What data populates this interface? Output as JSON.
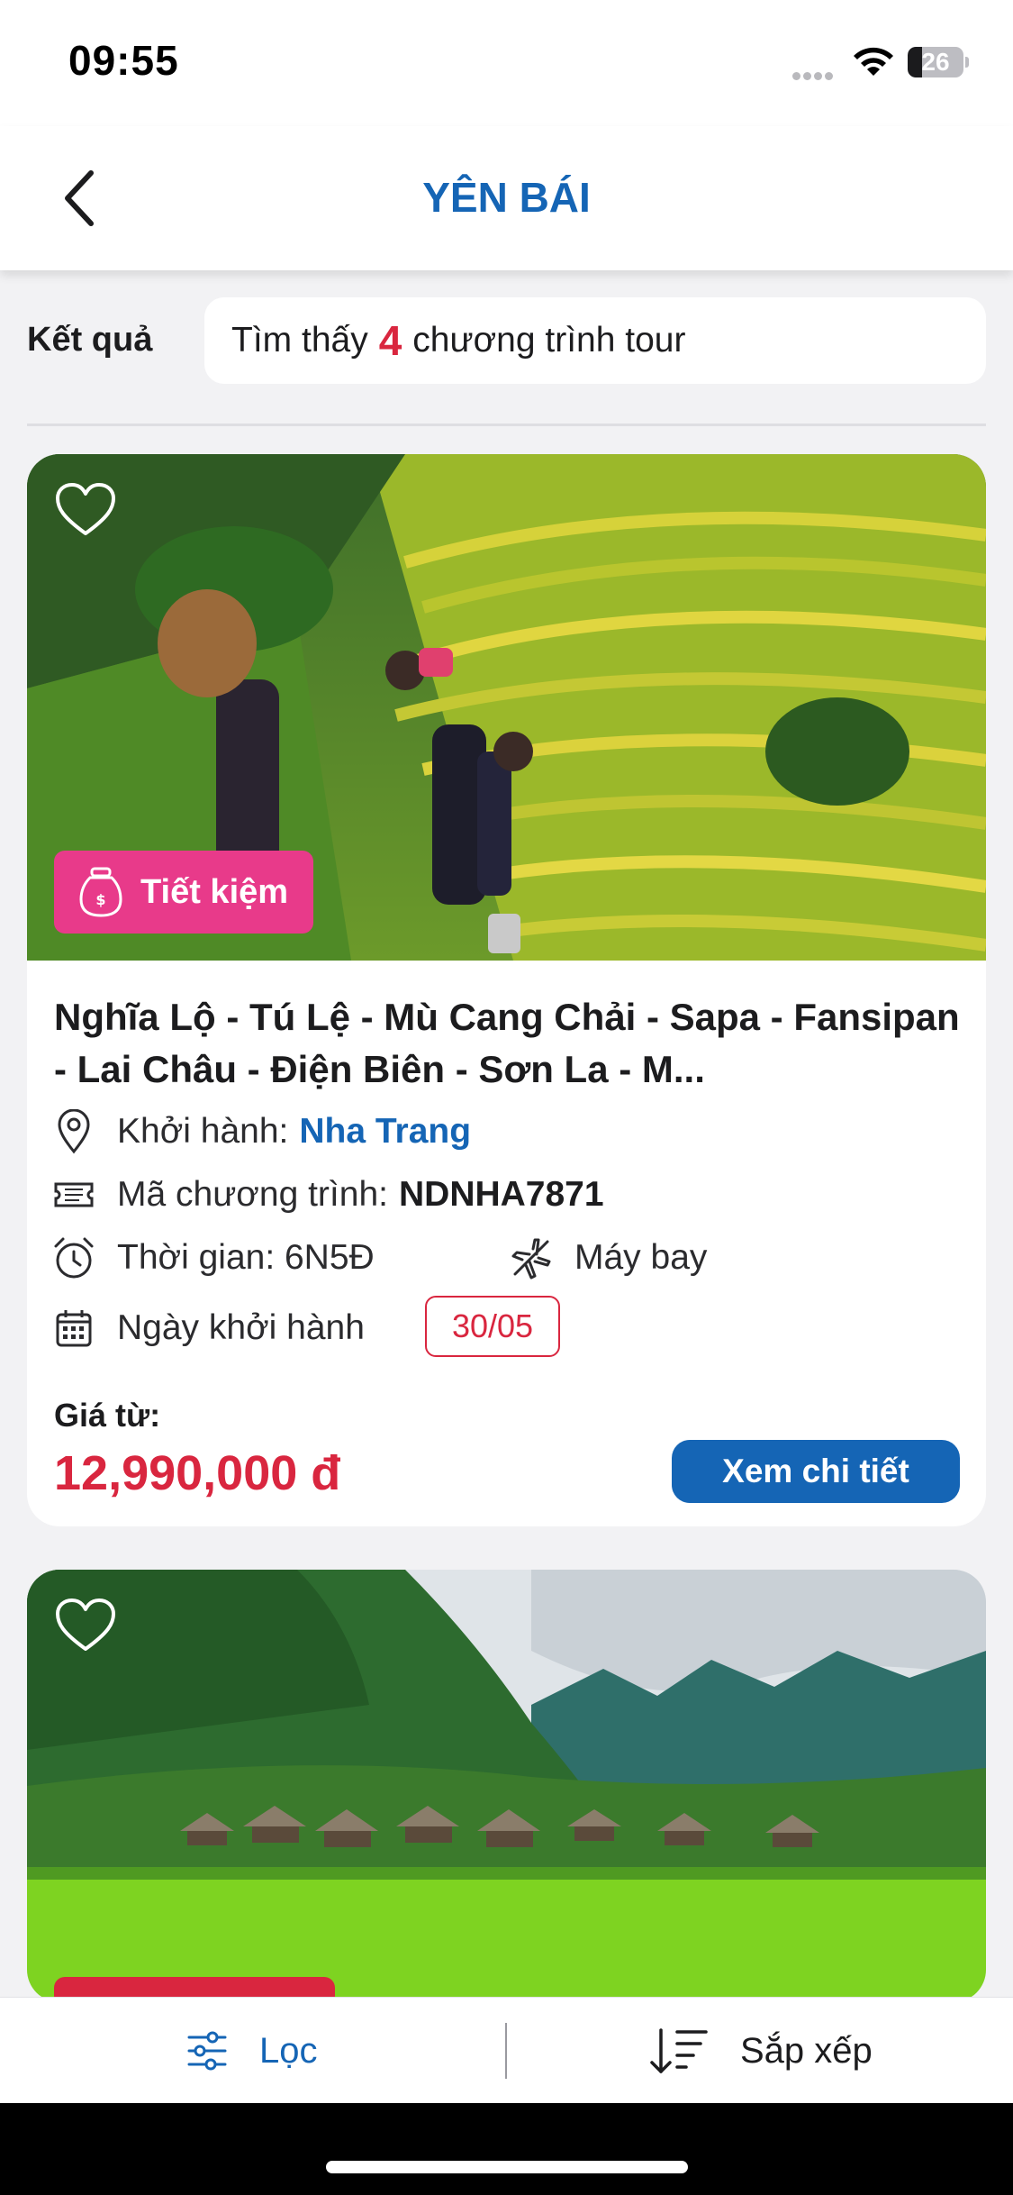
{
  "status_bar": {
    "time": "09:55",
    "battery": "26",
    "battery_level": 0.26
  },
  "header": {
    "title": "YÊN BÁI",
    "back_icon": "chevron-left-icon"
  },
  "results": {
    "label": "Kết quả",
    "prefix": "Tìm thấy",
    "count": "4",
    "suffix": "chương trình tour"
  },
  "tours": [
    {
      "badge": "Tiết kiệm",
      "title": "Nghĩa Lộ - Tú Lệ - Mù Cang Chải - Sapa - Fansipan - Lai Châu - Điện Biên - Sơn La - M...",
      "departure_label": "Khởi hành:",
      "departure": "Nha Trang",
      "code_label": "Mã chương trình:",
      "code": "NDNHA7871",
      "duration": "Thời gian: 6N5Đ",
      "transport": "Máy bay",
      "date_label": "Ngày khởi hành",
      "date": "30/05",
      "price_label": "Giá từ:",
      "price": "12,990,000 đ",
      "detail_button": "Xem chi tiết"
    }
  ],
  "bottom_bar": {
    "filter": "Lọc",
    "sort": "Sắp xếp"
  },
  "colors": {
    "brand_blue": "#1565b5",
    "accent_red": "#d9263f",
    "badge_pink": "#e83a8a"
  }
}
